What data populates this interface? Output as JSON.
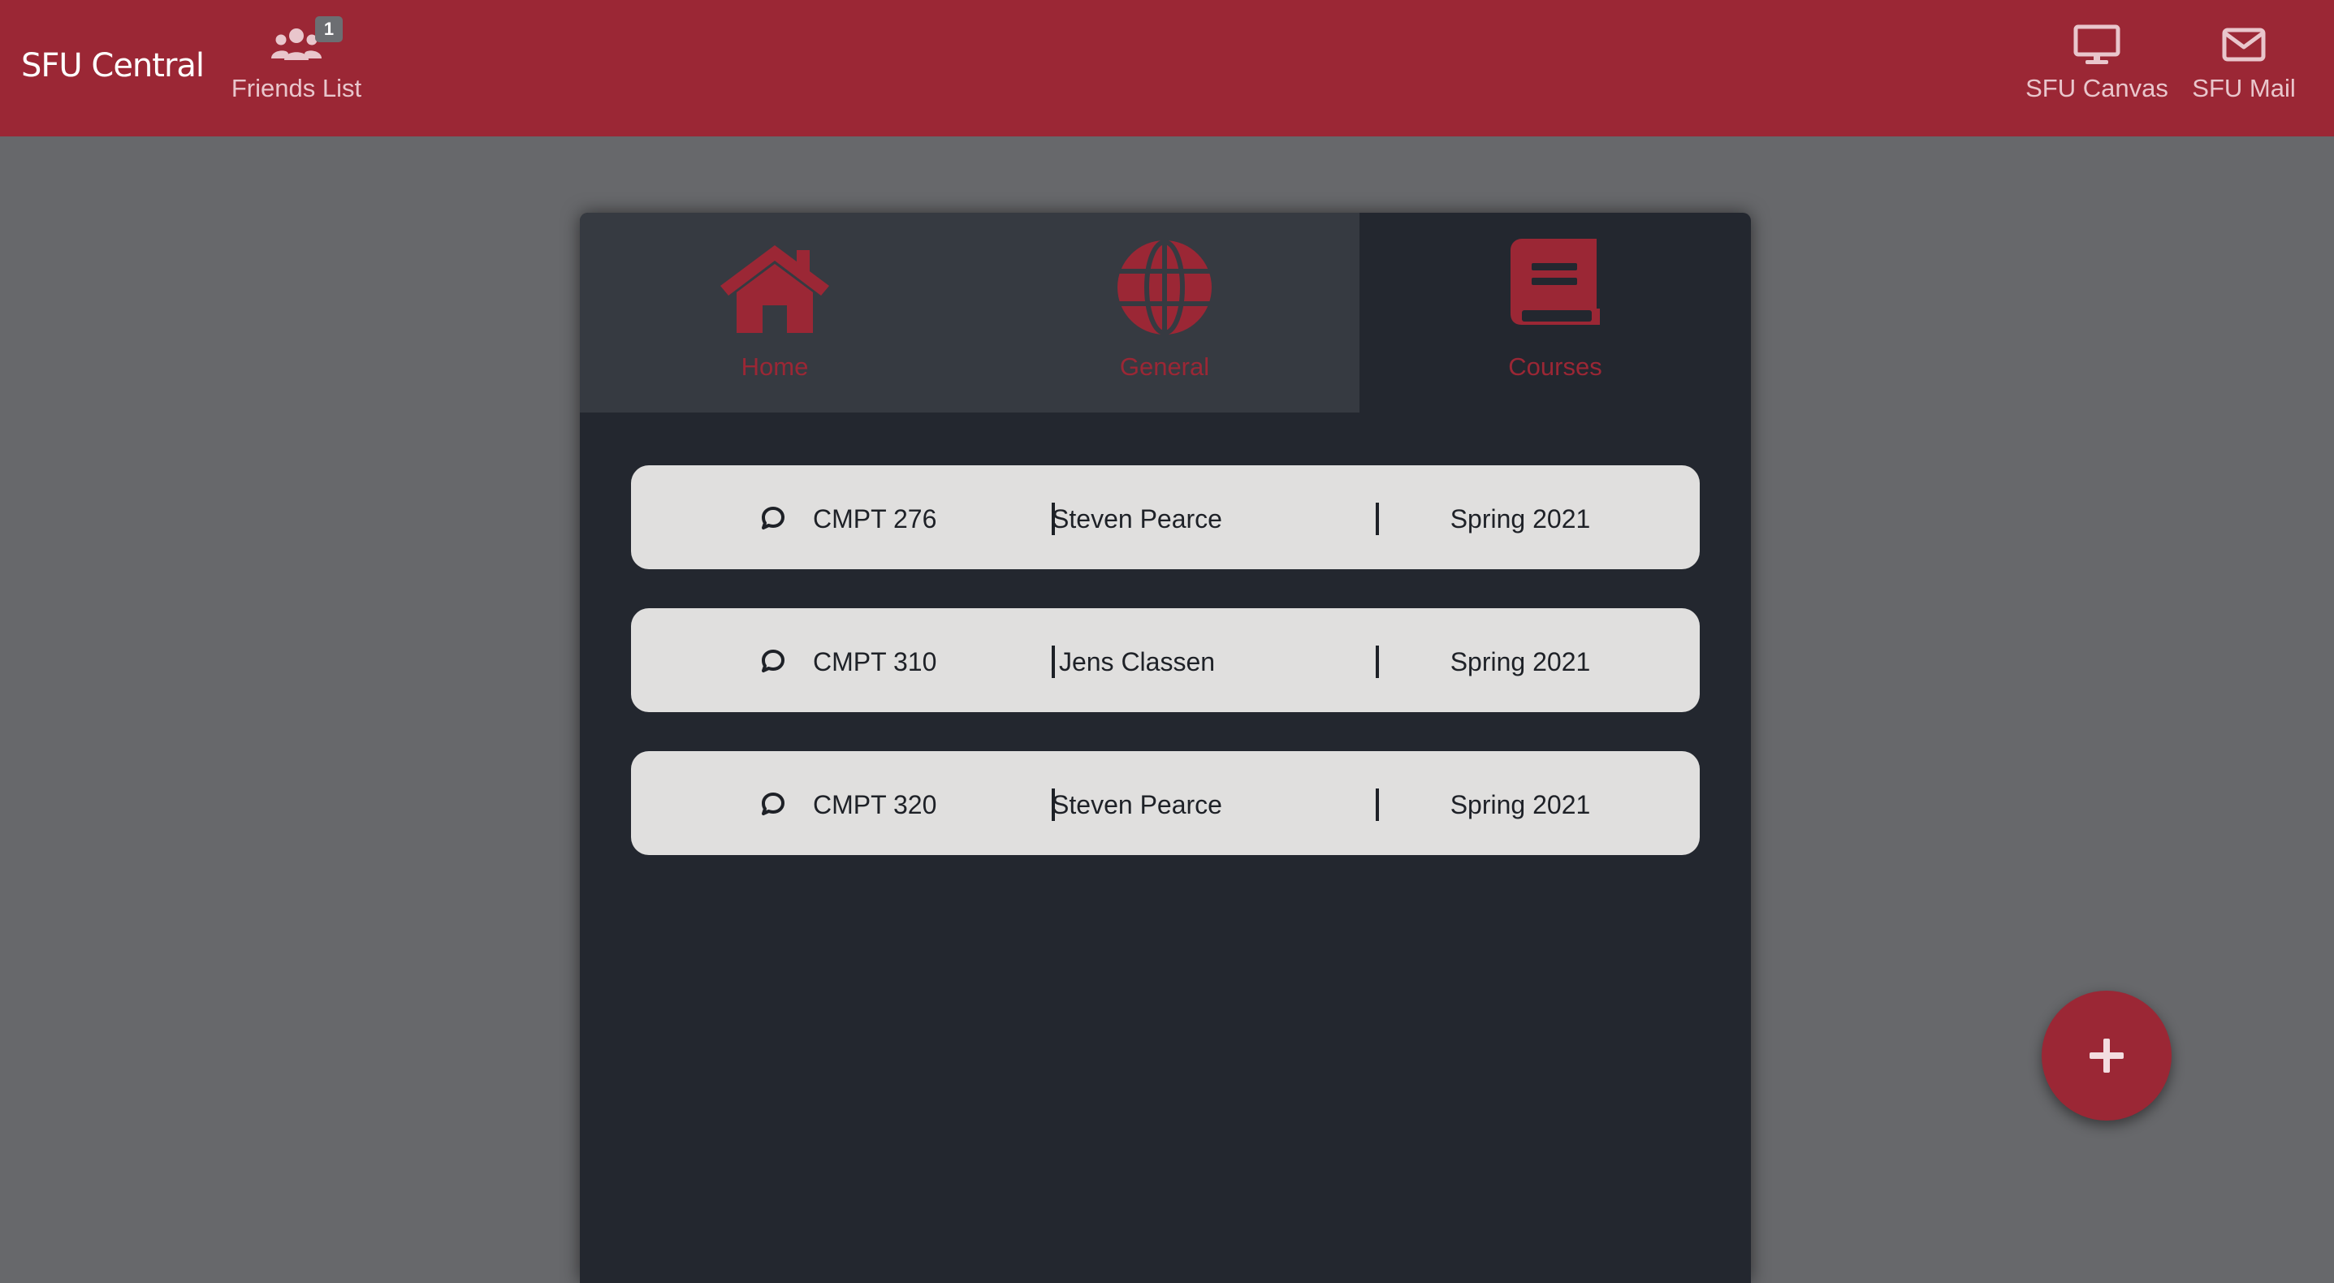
{
  "header": {
    "brand": "SFU Central",
    "friends": {
      "label": "Friends List",
      "badge": "1",
      "icon": "users-icon"
    },
    "canvas": {
      "label": "SFU Canvas",
      "icon": "monitor-icon"
    },
    "mail": {
      "label": "SFU Mail",
      "icon": "envelope-icon"
    }
  },
  "tabs": [
    {
      "label": "Home",
      "icon": "home-icon"
    },
    {
      "label": "General",
      "icon": "globe-icon"
    },
    {
      "label": "Courses",
      "icon": "book-icon",
      "active": true
    }
  ],
  "courses": [
    {
      "code": "CMPT 276",
      "instructor": "Steven Pearce",
      "term": "Spring 2021"
    },
    {
      "code": "CMPT 310",
      "instructor": "Jens Classen",
      "term": "Spring 2021"
    },
    {
      "code": "CMPT 320",
      "instructor": "Steven Pearce",
      "term": "Spring 2021"
    }
  ],
  "fab": {
    "icon": "plus-icon"
  },
  "colors": {
    "brand": "#9b2735",
    "page_background": "#67686b",
    "panel": "#23272f",
    "tab_inactive": "#363a41",
    "row": "#e0dfde"
  }
}
